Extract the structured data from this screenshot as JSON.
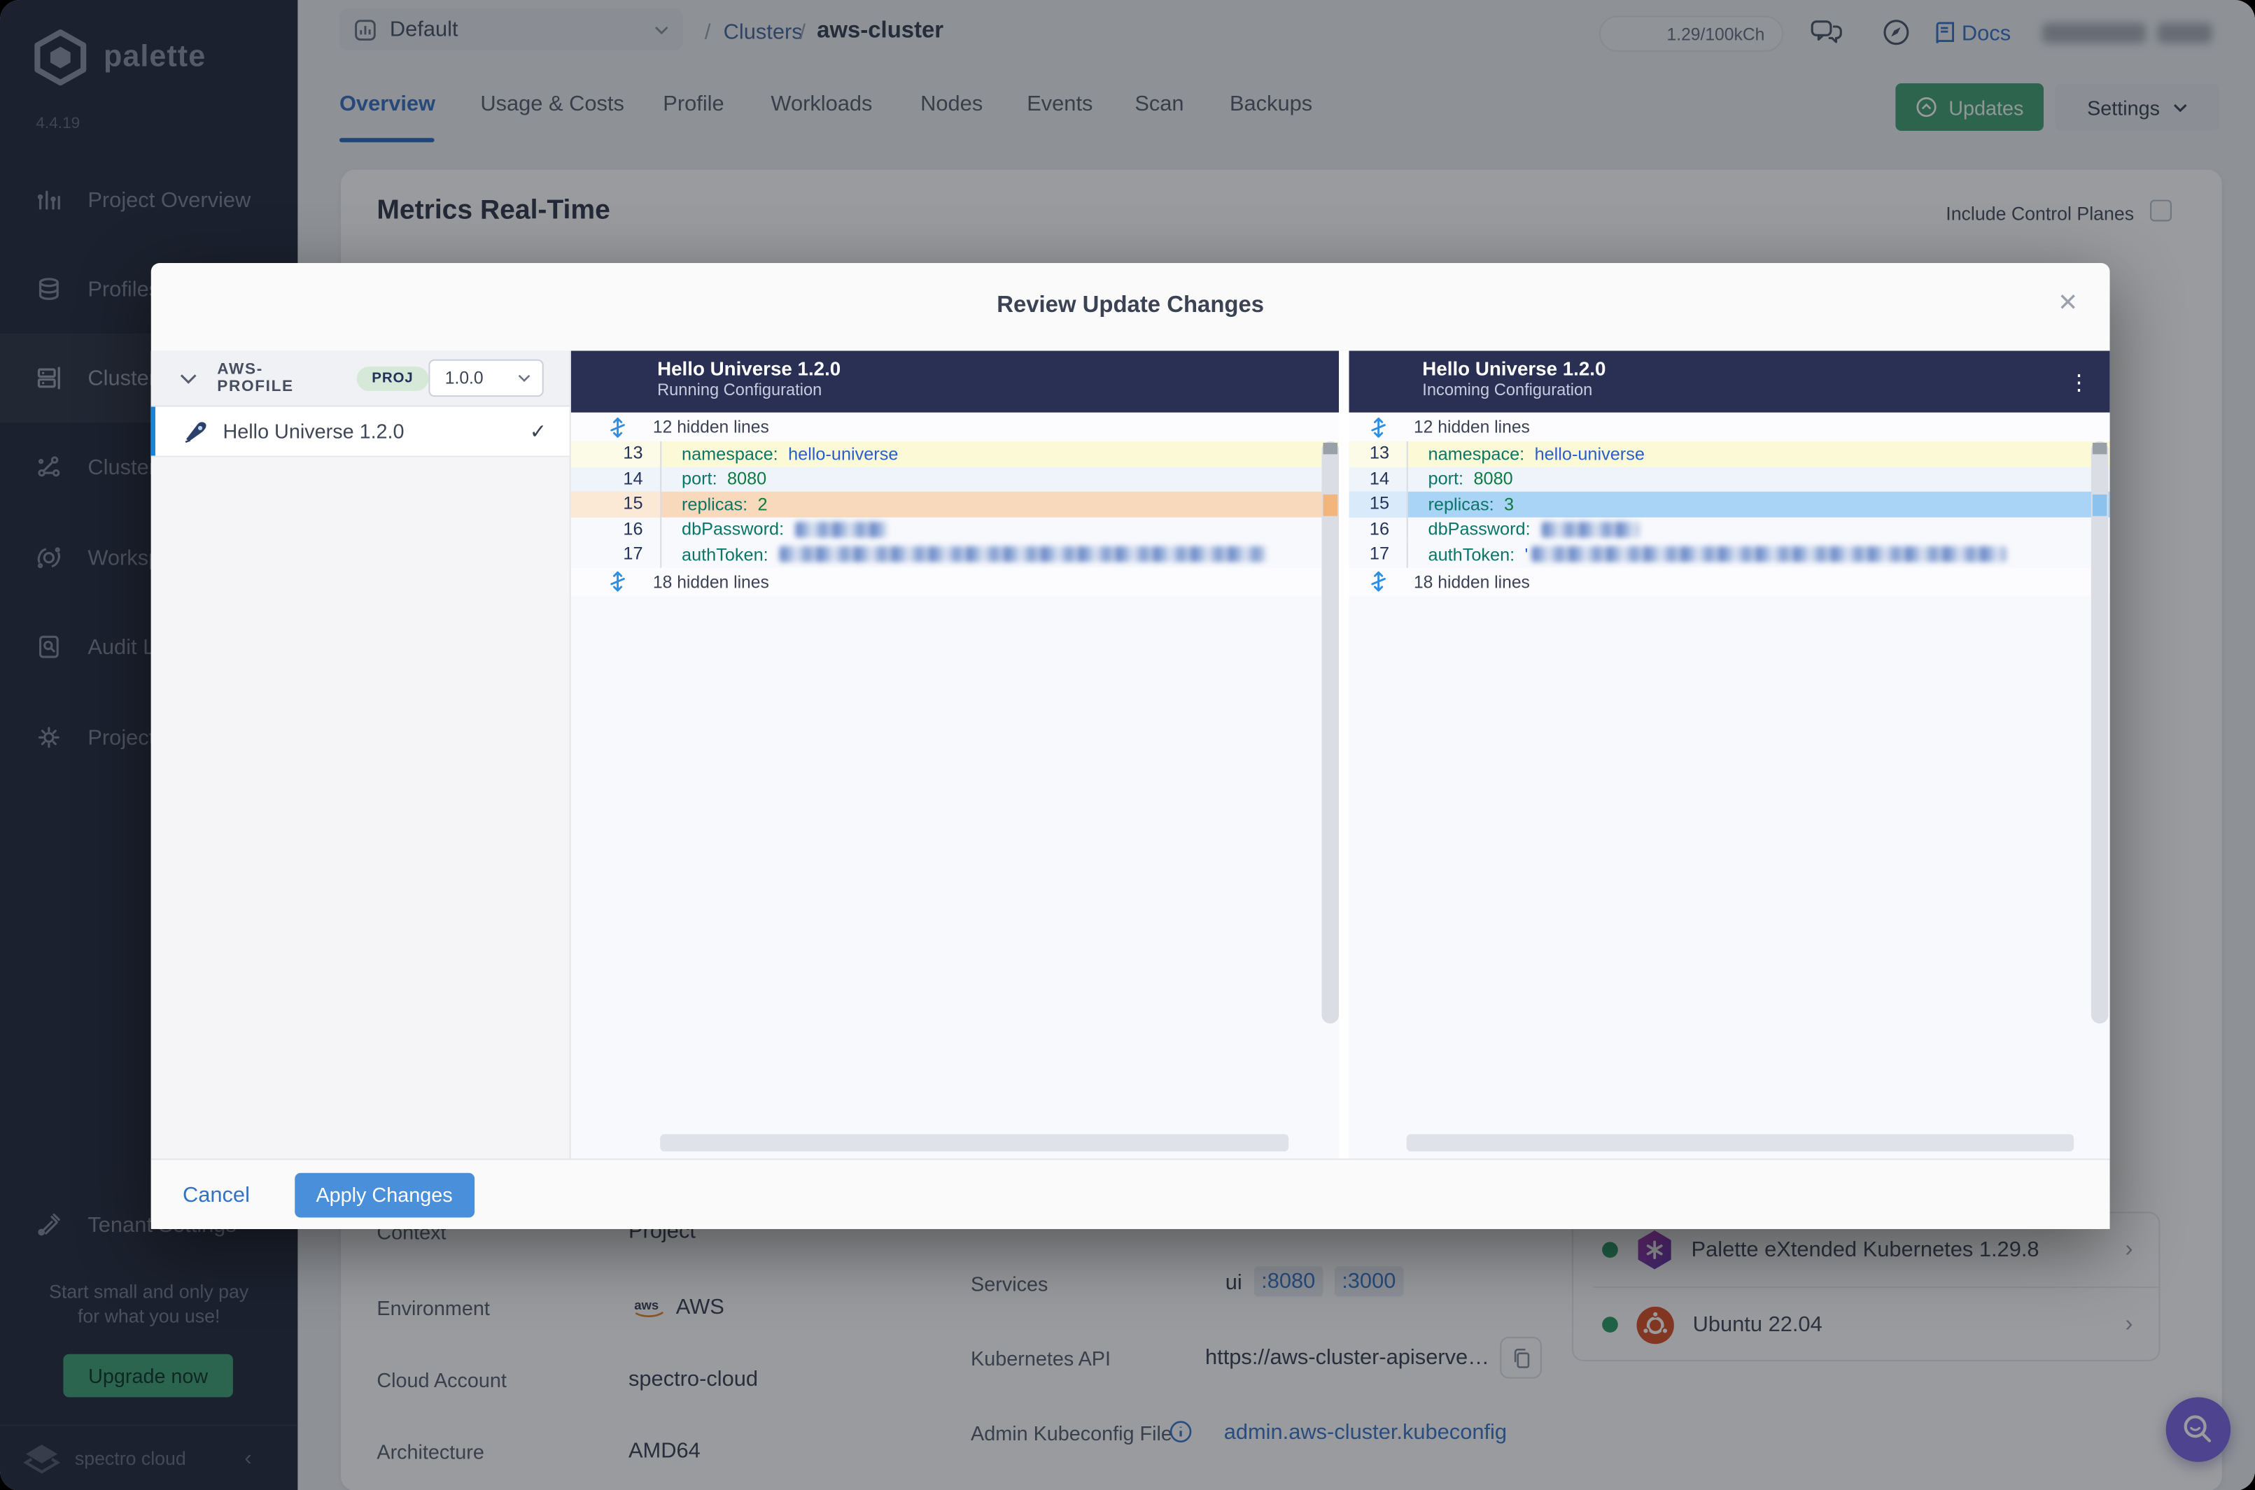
{
  "glyphs": {
    "kebab": "⋮",
    "check": "✓",
    "close": "✕",
    "chevron_right": "›",
    "chevron_left": "‹"
  },
  "colors": {
    "sidebar_bg": "#262e3f",
    "accent_blue": "#4a8fd9",
    "brand_green": "#45a176",
    "diff_removed_bg": "#f8d9bc",
    "diff_added_bg": "#a9d4f5",
    "diff_context_bg": "#fbf9d6",
    "fab_purple": "#7c68e4",
    "header_navy": "#2a3053"
  },
  "sidebar": {
    "brand": "palette",
    "version": "4.4.19",
    "items": [
      {
        "label": "Project Overview"
      },
      {
        "label": "Profiles"
      },
      {
        "label": "Clusters"
      },
      {
        "label": "Cluster Groups"
      },
      {
        "label": "Workspaces"
      },
      {
        "label": "Audit Logs"
      },
      {
        "label": "Project Settings"
      },
      {
        "label": "Tenant Settings"
      }
    ],
    "promo_line1": "Start small and only pay",
    "promo_line2": "for what you use!",
    "upgrade_label": "Upgrade now",
    "footer_brand": "spectro cloud"
  },
  "topbar": {
    "project": "Default",
    "breadcrumb_sep": "/",
    "breadcrumb": [
      {
        "label": "Clusters"
      },
      {
        "label": "aws-cluster"
      }
    ],
    "credits": "1.29/100kCh",
    "docs": "Docs"
  },
  "tabs": {
    "items": [
      "Overview",
      "Usage & Costs",
      "Profile",
      "Workloads",
      "Nodes",
      "Events",
      "Scan",
      "Backups"
    ],
    "updates": "Updates",
    "settings": "Settings"
  },
  "content": {
    "title": "Metrics Real-Time",
    "include_control_planes": "Include Control Planes",
    "details": [
      {
        "label": "Context",
        "value": "Project"
      },
      {
        "label": "Environment",
        "value": "AWS"
      },
      {
        "label": "Cloud Account",
        "value": "spectro-cloud"
      },
      {
        "label": "Architecture",
        "value": "AMD64"
      }
    ],
    "services_label": "Services",
    "services_value": "ui",
    "service_ports": [
      ":8080",
      ":3000"
    ],
    "k8s_api_label": "Kubernetes API",
    "k8s_api_value": "https://aws-cluster-apiserve…",
    "kubeconfig_label": "Admin Kubeconfig File",
    "kubeconfig_value": "admin.aws-cluster.kubeconfig",
    "packs": [
      {
        "name": "Palette eXtended Kubernetes 1.29.8"
      },
      {
        "name": "Ubuntu 22.04"
      }
    ]
  },
  "modal": {
    "title": "Review Update Changes",
    "profile_panel": {
      "name": "AWS-PROFILE",
      "scope_badge": "PROJ",
      "version": "1.0.0",
      "profile": "Hello Universe 1.2.0"
    },
    "diff": {
      "left": {
        "title": "Hello Universe 1.2.0",
        "subtitle": "Running Configuration",
        "hidden_top": "12 hidden lines",
        "hidden_bottom": "18 hidden lines",
        "lines": [
          {
            "n": "13",
            "k": "namespace:",
            "v": "hello-universe"
          },
          {
            "n": "14",
            "k": "port:",
            "v": "8080"
          },
          {
            "n": "15",
            "k": "replicas:",
            "v": "2"
          },
          {
            "n": "16",
            "k": "dbPassword:",
            "redacted": true
          },
          {
            "n": "17",
            "k": "authToken:",
            "redacted": true
          }
        ]
      },
      "right": {
        "title": "Hello Universe 1.2.0",
        "subtitle": "Incoming Configuration",
        "hidden_top": "12 hidden lines",
        "hidden_bottom": "18 hidden lines",
        "lines": [
          {
            "n": "13",
            "k": "namespace:",
            "v": "hello-universe"
          },
          {
            "n": "14",
            "k": "port:",
            "v": "8080"
          },
          {
            "n": "15",
            "k": "replicas:",
            "v": "3"
          },
          {
            "n": "16",
            "k": "dbPassword:",
            "redacted": true
          },
          {
            "n": "17",
            "k": "authToken:",
            "q": "'",
            "redacted": true
          }
        ]
      }
    },
    "cancel": "Cancel",
    "apply": "Apply Changes"
  }
}
